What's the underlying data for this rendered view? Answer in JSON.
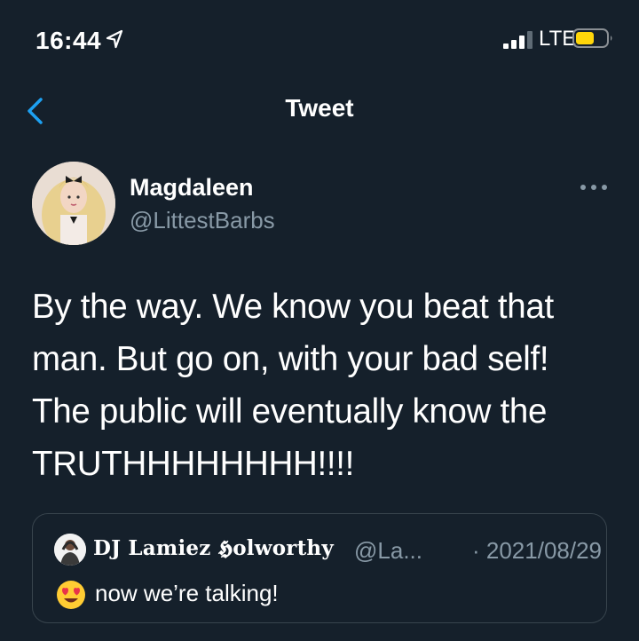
{
  "status_bar": {
    "time": "16:44",
    "network": "LTE",
    "icons": [
      "location-arrow-icon",
      "signal-bars-icon",
      "battery-icon"
    ],
    "battery_color": "#ffd60a"
  },
  "nav": {
    "title": "Tweet",
    "back_icon": "chevron-left-icon",
    "accent_color": "#1da1f2"
  },
  "tweet": {
    "author_name": "Magdaleen",
    "author_handle": "@LittestBarbs",
    "lines": [
      "By the way. We know you beat that",
      "man. But go on, with your bad self!",
      "The public will eventually know the",
      "TRUTHHHHHHHH!!!!"
    ],
    "more_icon": "more-horizontal-icon"
  },
  "quoted_tweet": {
    "author_name": "𝐃𝐉 𝐋𝐚𝐦𝐢𝐞𝐳 𝕳𝐨𝐥𝐰𝐨𝐫𝐭𝐡𝐲",
    "author_handle": "@La...",
    "date": "· 2021/08/29",
    "emoji": "heart-eyes-emoji",
    "text": "now we’re talking!"
  },
  "theme": {
    "background": "#15202b",
    "text": "#ffffff",
    "secondary_text": "#8899a6",
    "border": "#38444d"
  }
}
